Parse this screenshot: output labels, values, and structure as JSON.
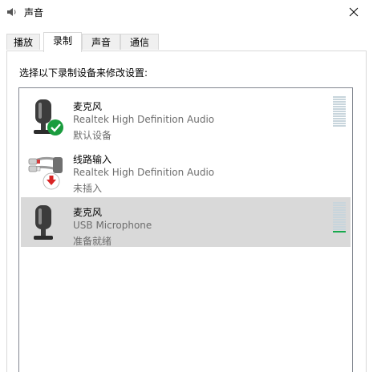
{
  "window": {
    "title": "声音",
    "icon": "speaker-icon",
    "close_icon": "close-icon"
  },
  "tabs": [
    {
      "label": "播放",
      "active": false
    },
    {
      "label": "录制",
      "active": true
    },
    {
      "label": "声音",
      "active": false
    },
    {
      "label": "通信",
      "active": false
    }
  ],
  "instruction": "选择以下录制设备来修改设置:",
  "devices": [
    {
      "name": "麦克风",
      "description": "Realtek High Definition Audio",
      "status": "默认设备",
      "icon": "microphone-icon",
      "badge": "default-check-icon",
      "selected": false,
      "level": 0
    },
    {
      "name": "线路输入",
      "description": "Realtek High Definition Audio",
      "status": "未插入",
      "icon": "line-in-cable-icon",
      "badge": "unplugged-arrow-icon",
      "selected": false,
      "level": null
    },
    {
      "name": "麦克风",
      "description": "USB Microphone",
      "status": "准备就绪",
      "icon": "microphone-icon",
      "badge": null,
      "selected": true,
      "level": 0.05
    }
  ],
  "colors": {
    "selected_row": "#d9d9d9",
    "meter_off": "#c8d5dc",
    "meter_on": "#17a94d",
    "badge_green": "#1a9c3e",
    "badge_red": "#d92424"
  }
}
